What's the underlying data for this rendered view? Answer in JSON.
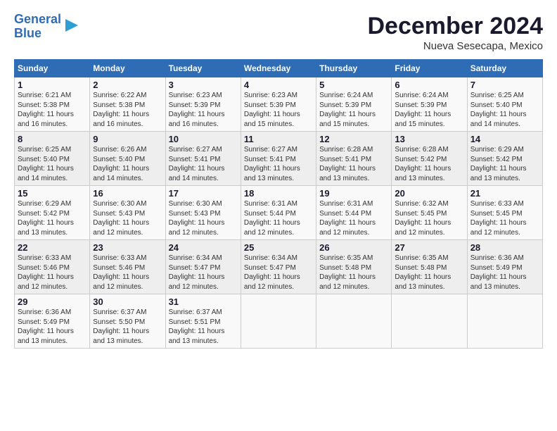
{
  "header": {
    "logo_line1": "General",
    "logo_line2": "Blue",
    "main_title": "December 2024",
    "subtitle": "Nueva Sesecapa, Mexico"
  },
  "calendar": {
    "days_of_week": [
      "Sunday",
      "Monday",
      "Tuesday",
      "Wednesday",
      "Thursday",
      "Friday",
      "Saturday"
    ],
    "weeks": [
      [
        null,
        {
          "day": "2",
          "sunrise": "Sunrise: 6:22 AM",
          "sunset": "Sunset: 5:38 PM",
          "daylight": "Daylight: 11 hours and 16 minutes."
        },
        {
          "day": "3",
          "sunrise": "Sunrise: 6:23 AM",
          "sunset": "Sunset: 5:39 PM",
          "daylight": "Daylight: 11 hours and 16 minutes."
        },
        {
          "day": "4",
          "sunrise": "Sunrise: 6:23 AM",
          "sunset": "Sunset: 5:39 PM",
          "daylight": "Daylight: 11 hours and 15 minutes."
        },
        {
          "day": "5",
          "sunrise": "Sunrise: 6:24 AM",
          "sunset": "Sunset: 5:39 PM",
          "daylight": "Daylight: 11 hours and 15 minutes."
        },
        {
          "day": "6",
          "sunrise": "Sunrise: 6:24 AM",
          "sunset": "Sunset: 5:39 PM",
          "daylight": "Daylight: 11 hours and 15 minutes."
        },
        {
          "day": "7",
          "sunrise": "Sunrise: 6:25 AM",
          "sunset": "Sunset: 5:40 PM",
          "daylight": "Daylight: 11 hours and 14 minutes."
        }
      ],
      [
        {
          "day": "1",
          "sunrise": "Sunrise: 6:21 AM",
          "sunset": "Sunset: 5:38 PM",
          "daylight": "Daylight: 11 hours and 16 minutes."
        },
        null,
        null,
        null,
        null,
        null,
        null
      ],
      [
        {
          "day": "8",
          "sunrise": "Sunrise: 6:25 AM",
          "sunset": "Sunset: 5:40 PM",
          "daylight": "Daylight: 11 hours and 14 minutes."
        },
        {
          "day": "9",
          "sunrise": "Sunrise: 6:26 AM",
          "sunset": "Sunset: 5:40 PM",
          "daylight": "Daylight: 11 hours and 14 minutes."
        },
        {
          "day": "10",
          "sunrise": "Sunrise: 6:27 AM",
          "sunset": "Sunset: 5:41 PM",
          "daylight": "Daylight: 11 hours and 14 minutes."
        },
        {
          "day": "11",
          "sunrise": "Sunrise: 6:27 AM",
          "sunset": "Sunset: 5:41 PM",
          "daylight": "Daylight: 11 hours and 13 minutes."
        },
        {
          "day": "12",
          "sunrise": "Sunrise: 6:28 AM",
          "sunset": "Sunset: 5:41 PM",
          "daylight": "Daylight: 11 hours and 13 minutes."
        },
        {
          "day": "13",
          "sunrise": "Sunrise: 6:28 AM",
          "sunset": "Sunset: 5:42 PM",
          "daylight": "Daylight: 11 hours and 13 minutes."
        },
        {
          "day": "14",
          "sunrise": "Sunrise: 6:29 AM",
          "sunset": "Sunset: 5:42 PM",
          "daylight": "Daylight: 11 hours and 13 minutes."
        }
      ],
      [
        {
          "day": "15",
          "sunrise": "Sunrise: 6:29 AM",
          "sunset": "Sunset: 5:42 PM",
          "daylight": "Daylight: 11 hours and 13 minutes."
        },
        {
          "day": "16",
          "sunrise": "Sunrise: 6:30 AM",
          "sunset": "Sunset: 5:43 PM",
          "daylight": "Daylight: 11 hours and 12 minutes."
        },
        {
          "day": "17",
          "sunrise": "Sunrise: 6:30 AM",
          "sunset": "Sunset: 5:43 PM",
          "daylight": "Daylight: 11 hours and 12 minutes."
        },
        {
          "day": "18",
          "sunrise": "Sunrise: 6:31 AM",
          "sunset": "Sunset: 5:44 PM",
          "daylight": "Daylight: 11 hours and 12 minutes."
        },
        {
          "day": "19",
          "sunrise": "Sunrise: 6:31 AM",
          "sunset": "Sunset: 5:44 PM",
          "daylight": "Daylight: 11 hours and 12 minutes."
        },
        {
          "day": "20",
          "sunrise": "Sunrise: 6:32 AM",
          "sunset": "Sunset: 5:45 PM",
          "daylight": "Daylight: 11 hours and 12 minutes."
        },
        {
          "day": "21",
          "sunrise": "Sunrise: 6:33 AM",
          "sunset": "Sunset: 5:45 PM",
          "daylight": "Daylight: 11 hours and 12 minutes."
        }
      ],
      [
        {
          "day": "22",
          "sunrise": "Sunrise: 6:33 AM",
          "sunset": "Sunset: 5:46 PM",
          "daylight": "Daylight: 11 hours and 12 minutes."
        },
        {
          "day": "23",
          "sunrise": "Sunrise: 6:33 AM",
          "sunset": "Sunset: 5:46 PM",
          "daylight": "Daylight: 11 hours and 12 minutes."
        },
        {
          "day": "24",
          "sunrise": "Sunrise: 6:34 AM",
          "sunset": "Sunset: 5:47 PM",
          "daylight": "Daylight: 11 hours and 12 minutes."
        },
        {
          "day": "25",
          "sunrise": "Sunrise: 6:34 AM",
          "sunset": "Sunset: 5:47 PM",
          "daylight": "Daylight: 11 hours and 12 minutes."
        },
        {
          "day": "26",
          "sunrise": "Sunrise: 6:35 AM",
          "sunset": "Sunset: 5:48 PM",
          "daylight": "Daylight: 11 hours and 12 minutes."
        },
        {
          "day": "27",
          "sunrise": "Sunrise: 6:35 AM",
          "sunset": "Sunset: 5:48 PM",
          "daylight": "Daylight: 11 hours and 13 minutes."
        },
        {
          "day": "28",
          "sunrise": "Sunrise: 6:36 AM",
          "sunset": "Sunset: 5:49 PM",
          "daylight": "Daylight: 11 hours and 13 minutes."
        }
      ],
      [
        {
          "day": "29",
          "sunrise": "Sunrise: 6:36 AM",
          "sunset": "Sunset: 5:49 PM",
          "daylight": "Daylight: 11 hours and 13 minutes."
        },
        {
          "day": "30",
          "sunrise": "Sunrise: 6:37 AM",
          "sunset": "Sunset: 5:50 PM",
          "daylight": "Daylight: 11 hours and 13 minutes."
        },
        {
          "day": "31",
          "sunrise": "Sunrise: 6:37 AM",
          "sunset": "Sunset: 5:51 PM",
          "daylight": "Daylight: 11 hours and 13 minutes."
        },
        null,
        null,
        null,
        null
      ]
    ]
  }
}
